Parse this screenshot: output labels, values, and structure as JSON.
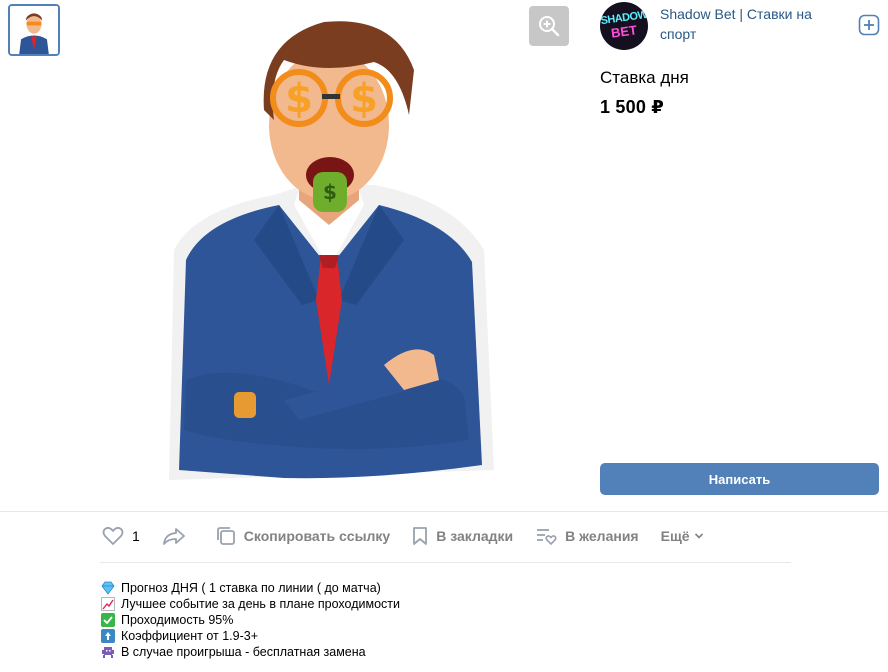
{
  "seller": {
    "name": "Shadow Bet | Ставки на спорт",
    "logo_line1": "SHADOW",
    "logo_line2": "BET"
  },
  "product": {
    "title": "Ставка дня",
    "price": "1 500 ₽"
  },
  "buttons": {
    "write": "Написать"
  },
  "actions": {
    "likes": "1",
    "copy_link": "Скопировать ссылку",
    "bookmarks": "В закладки",
    "wishlist": "В желания",
    "more": "Ещё"
  },
  "description": [
    "Прогноз ДНЯ ( 1 ставка по линии ( до матча)",
    "Лучшее событие за день в плане проходимости",
    "Проходимость 95%",
    "Коэффициент от 1.9-3+",
    "В случае проигрыша - бесплатная замена"
  ],
  "icons": {
    "line1": "gem-icon",
    "line2": "chart-up-icon",
    "line3": "check-mark-icon",
    "line4": "top-arrow-icon",
    "line5": "alien-monster-icon"
  },
  "colors": {
    "accent": "#5181b8",
    "link": "#2a5885",
    "muted": "#828282"
  }
}
